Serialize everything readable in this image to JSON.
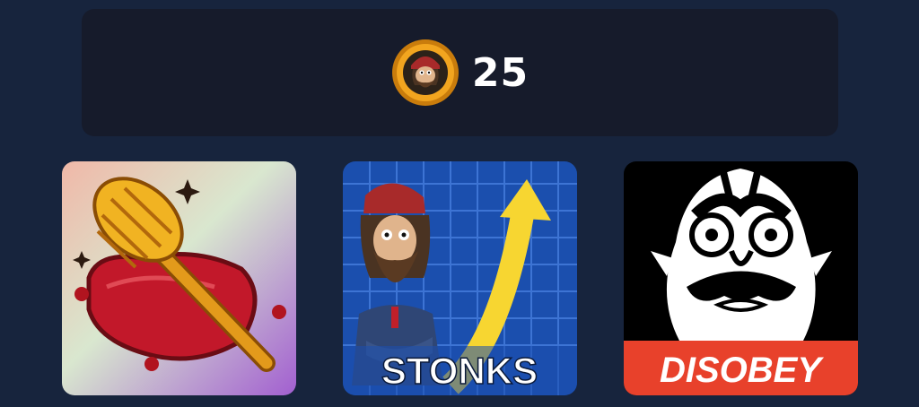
{
  "balance": {
    "amount": "25",
    "coin_icon": "bearded-man-coin-icon"
  },
  "cards": [
    {
      "name": "brush-pillow",
      "caption": ""
    },
    {
      "name": "stonks",
      "caption": "STONKS"
    },
    {
      "name": "disobey",
      "caption": "DISOBEY"
    }
  ],
  "colors": {
    "page_background": "#17243d",
    "panel_background": "#161b2b",
    "coin_gold": "#f2a51f",
    "disobey_red": "#e8412b",
    "stonks_arrow": "#f7d631"
  }
}
